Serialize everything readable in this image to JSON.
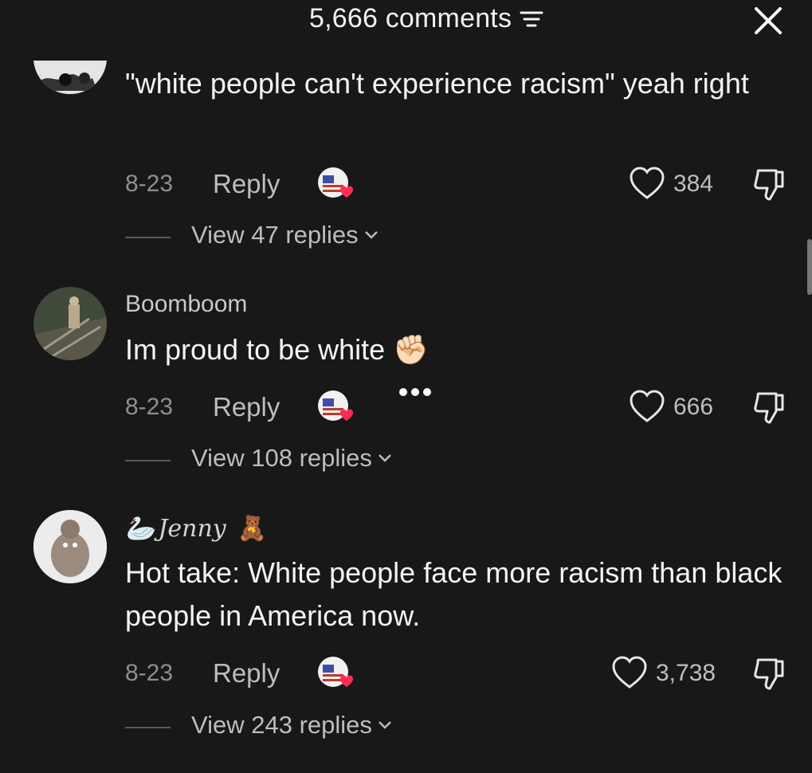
{
  "header": {
    "title": "5,666 comments",
    "sort_icon": "filter-lines-icon",
    "close_icon": "close-icon"
  },
  "comments": [
    {
      "username": "",
      "text": "\"white people can't experience racism\" yeah right",
      "date": "8-23",
      "reply_label": "Reply",
      "likes": "384",
      "view_replies": "View 47 replies"
    },
    {
      "username": "Boomboom",
      "text": "Im proud to be white ✊🏻",
      "date": "8-23",
      "reply_label": "Reply",
      "likes": "666",
      "view_replies": "View 108 replies"
    },
    {
      "username": "Jenny",
      "username_prefix": "🦢",
      "username_suffix": "🧸",
      "text": "Hot take: White people face more racism than black people in America now.",
      "date": "8-23",
      "reply_label": "Reply",
      "likes": "3,738",
      "view_replies": "View 243 replies"
    }
  ],
  "colors": {
    "background": "#181818",
    "text_primary": "#f4f4f4",
    "text_secondary": "#8e8e8e",
    "creator_heart": "#fe2c55"
  }
}
